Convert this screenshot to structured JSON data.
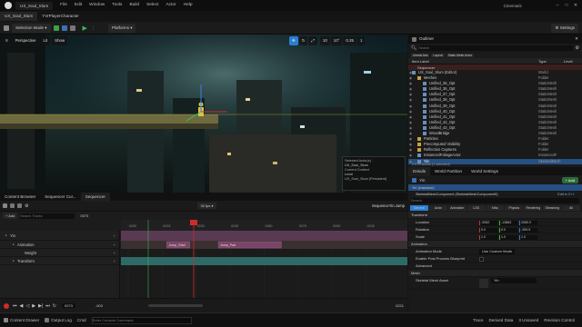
{
  "menubar": {
    "project_tab": "UX_Soul_Slum",
    "menus": [
      "File",
      "Edit",
      "Window",
      "Tools",
      "Build",
      "Select",
      "Actor",
      "Help"
    ],
    "app_title": "Cinematic"
  },
  "toolbar": {
    "level_tab": "UX_Soul_Slum",
    "character_tab": "YVrPlayerCharacter",
    "selection_mode": "Selection Mode",
    "platforms": "Platforms",
    "settings": "Settings"
  },
  "viewport": {
    "perspective": "Perspective",
    "lit": "Lit",
    "show": "Show",
    "grid_value": "10",
    "angle_value": "10°",
    "scale_value": "0.25",
    "camera_speed": "1",
    "context": {
      "selected_actor_header": "Selected Actor(s)",
      "selected_actor_value": "UX_Soul_Slum",
      "current_context_header": "Current Context",
      "level_label": "Level",
      "level_value": "UX_Soul_Slum (Persistent)"
    }
  },
  "outliner": {
    "title": "Outliner",
    "search_placeholder": "Search",
    "filters": [
      "Unreal Ask",
      "Layout",
      "Static Mesh Actor"
    ],
    "col_item": "Item Label",
    "col_type": "Type",
    "col_level": "Level",
    "sequencer_header": "Sequencer",
    "rows": [
      {
        "label": "UX_Soul_Slum (Editor)",
        "type": "World"
      },
      {
        "label": "Meshes",
        "type": "Folder"
      },
      {
        "label": "Unified_35_Opt",
        "type": "StaticMesh"
      },
      {
        "label": "Unified_36_Opt",
        "type": "StaticMesh"
      },
      {
        "label": "Unified_37_Opt",
        "type": "StaticMesh"
      },
      {
        "label": "Unified_38_Opt",
        "type": "StaticMesh"
      },
      {
        "label": "Unified_39_Opt",
        "type": "StaticMesh"
      },
      {
        "label": "Unified_40_Opt",
        "type": "StaticMesh"
      },
      {
        "label": "Unified_41_Opt",
        "type": "StaticMesh"
      },
      {
        "label": "Unified_42_Opt",
        "type": "StaticMesh"
      },
      {
        "label": "Unified_43_Opt",
        "type": "StaticMesh"
      },
      {
        "label": "WoodBridge",
        "type": "StaticMesh"
      },
      {
        "label": "Particles",
        "type": "Folder"
      },
      {
        "label": "Precomputed Visibility",
        "type": "Folder"
      },
      {
        "label": "Reflection Captures",
        "type": "Folder"
      },
      {
        "label": "InstancedFoliageActor",
        "type": "InstancedF"
      },
      {
        "label": "Yin",
        "type": "SkeletalMesh",
        "selected": true
      }
    ],
    "footer": "2,576 actors (1 selected)"
  },
  "details": {
    "tabs": [
      "Details",
      "World Partition",
      "World Settings"
    ],
    "actor_name": "Yin",
    "add_label": "+ Add",
    "instance": "Yin (Instance)",
    "component": "SkeletalMeshComponent (SkeletalMeshComponent0)",
    "edit_in_cpp": "Edit in C++",
    "search_placeholder": "Search",
    "filter_tabs": [
      "General",
      "Actor",
      "Animation",
      "LOD",
      "Misc",
      "Physics",
      "Rendering",
      "Streaming",
      "All"
    ],
    "transform_header": "Transform",
    "location_label": "Location",
    "location": [
      "-9352",
      "-13863",
      "2060.0"
    ],
    "rotation_label": "Rotation",
    "rotation": [
      "0.0",
      "0.0",
      "-359.5"
    ],
    "scale_label": "Scale",
    "scale": [
      "1.0",
      "1.0",
      "1.0"
    ],
    "animation_header": "Animation",
    "anim_mode_label": "Animation Mode",
    "anim_mode_value": "Use Custom Mode",
    "physics_label": "Enable Post Process Blueprint",
    "advanced_label": "Advanced",
    "mesh_header": "Mesh",
    "skeletal_mesh_label": "Skeletal Mesh Asset",
    "skeletal_mesh_value": "Yin"
  },
  "sequencer": {
    "tabs": [
      "Content Browser",
      "Sequencer Cur...",
      "Sequencer"
    ],
    "sequence_name": "SequenceYin.Jump",
    "add_label": "+ Add",
    "search_placeholder": "Search Tracks",
    "fps": "30 fps",
    "current_frame": "0073",
    "tracks": [
      {
        "name": "Yin",
        "indent": 0
      },
      {
        "name": "Animation",
        "indent": 1
      },
      {
        "name": "Weight",
        "indent": 2
      },
      {
        "name": "Transform",
        "indent": 1
      }
    ],
    "clips": [
      {
        "label": "Jump_Start",
        "start": 0.16,
        "end": 0.24
      },
      {
        "label": "Jump_Pad",
        "start": 0.34,
        "end": 0.56
      }
    ],
    "ruler_labels": [
      "0000",
      "0015",
      "0030",
      "0045",
      "0060",
      "0075",
      "0090",
      "0105"
    ],
    "start_frame": "-003",
    "end_frame": "0015",
    "frame_readout": "0073",
    "end_readout": "0221"
  },
  "statusbar": {
    "content_drawer": "Content Drawer",
    "output_log": "Output Log",
    "cmd": "Cmd",
    "console_placeholder": "Enter Console Command",
    "trace": "Trace",
    "derived_data": "Derived Data",
    "unsaved": "3 Unsaved",
    "source_control": "Revision Control"
  },
  "colors": {
    "accent_blue": "#2a7fd4",
    "playhead_red": "#d02b2b",
    "selection": "#264f82",
    "clip_magenta": "#7a4466",
    "transform_teal": "#2f6a66"
  }
}
